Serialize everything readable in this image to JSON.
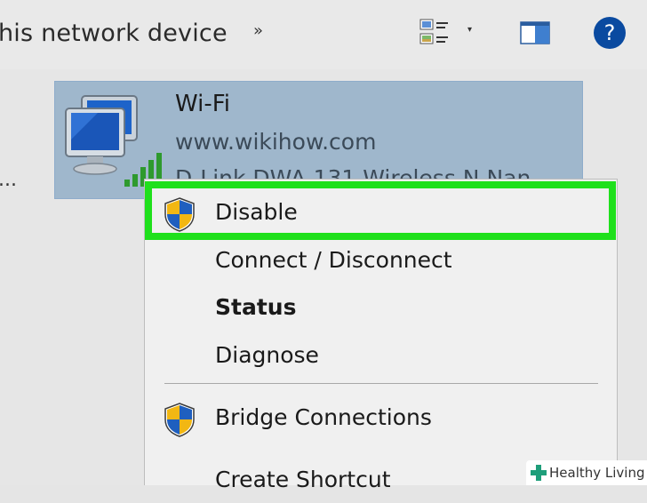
{
  "toolbar": {
    "partial_title": "his network device",
    "chevron": "»",
    "view_caret": "▾",
    "help_symbol": "?"
  },
  "sidebar": {
    "ellipsis": "..."
  },
  "adapter": {
    "name": "Wi-Fi",
    "domain": "www.wikihow.com",
    "device": "D-Link DWA-131 Wireless N Nan"
  },
  "context_menu": {
    "items": [
      {
        "label": "Disable",
        "icon": "shield-icon",
        "highlighted": true
      },
      {
        "label": "Connect / Disconnect"
      },
      {
        "label": "Status",
        "bold": true
      },
      {
        "label": "Diagnose"
      },
      {
        "label": "Bridge Connections",
        "icon": "shield-icon"
      },
      {
        "label": "Create Shortcut"
      }
    ]
  },
  "colors": {
    "highlight_border": "#1fe01c",
    "selection": "#9fb7cc",
    "help_button": "#0a4aa0"
  },
  "watermark": {
    "text": "Healthy Living"
  }
}
